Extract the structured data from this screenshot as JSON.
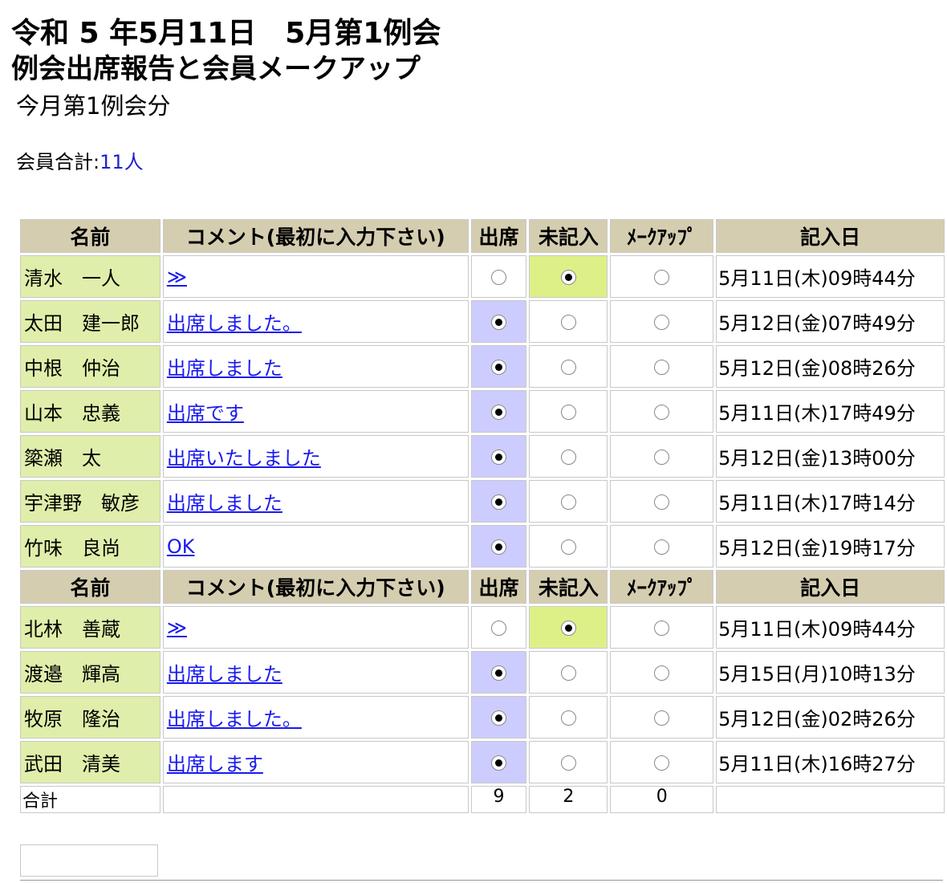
{
  "header": {
    "title_line1": "令和 5 年5月11日　5月第1例会",
    "title_line2": "例会出席報告と会員メークアップ",
    "subtitle": "今月第1例会分",
    "member_total_label": "会員合計:",
    "member_total_value": "11人"
  },
  "table": {
    "columns": [
      "名前",
      "コメント(最初に入力下さい)",
      "出席",
      "未記入",
      "ﾒｰｸｱｯﾌﾟ",
      "記入日"
    ],
    "rows_group1": [
      {
        "name": "清水　一人",
        "comment": "≫",
        "status": "未記入",
        "date": "5月11日(木)09時44分"
      },
      {
        "name": "太田　建一郎",
        "comment": "出席しました。",
        "status": "出席",
        "date": "5月12日(金)07時49分"
      },
      {
        "name": "中根　仲治",
        "comment": "出席しました",
        "status": "出席",
        "date": "5月12日(金)08時26分"
      },
      {
        "name": "山本　忠義",
        "comment": "出席です",
        "status": "出席",
        "date": "5月11日(木)17時49分"
      },
      {
        "name": "簗瀬　太",
        "comment": "出席いたしました",
        "status": "出席",
        "date": "5月12日(金)13時00分"
      },
      {
        "name": "宇津野　敏彦",
        "comment": "出席しました",
        "status": "出席",
        "date": "5月11日(木)17時14分"
      },
      {
        "name": "竹味　良尚",
        "comment": "OK",
        "status": "出席",
        "date": "5月12日(金)19時17分"
      }
    ],
    "rows_group2": [
      {
        "name": "北林　善蔵",
        "comment": "≫",
        "status": "未記入",
        "date": "5月11日(木)09時44分"
      },
      {
        "name": "渡邉　輝高",
        "comment": "出席しました",
        "status": "出席",
        "date": "5月15日(月)10時13分"
      },
      {
        "name": "牧原　隆治",
        "comment": "出席しました。",
        "status": "出席",
        "date": "5月12日(金)02時26分"
      },
      {
        "name": "武田　清美",
        "comment": "出席します",
        "status": "出席",
        "date": "5月11日(木)16時27分"
      }
    ],
    "totals": {
      "label": "合計",
      "attended": "9",
      "unrecorded": "2",
      "makeup": "0"
    }
  },
  "colors": {
    "header_bg": "#d4cdb0",
    "name_bg": "#dfeeaa",
    "attended_selected_bg": "#ccccff",
    "unrecorded_selected_bg": "#ddf088",
    "link": "#1a1aee"
  }
}
